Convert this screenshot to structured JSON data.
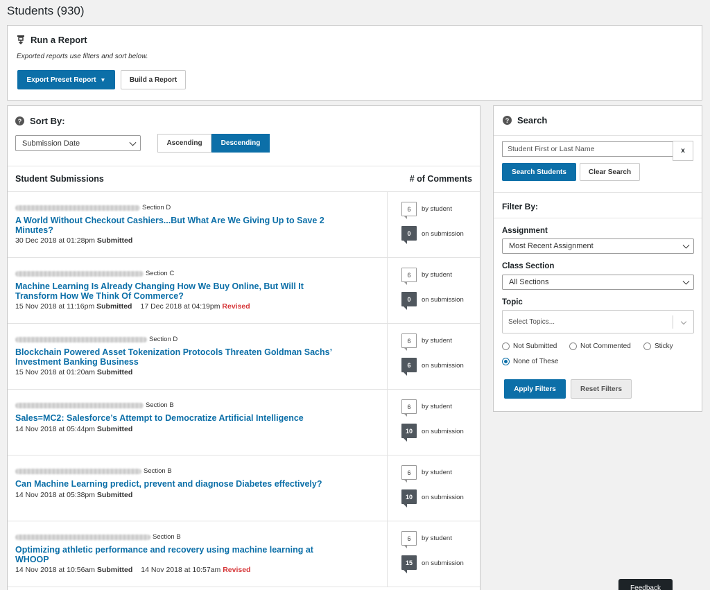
{
  "page": {
    "title": "Students (930)"
  },
  "report": {
    "heading": "Run a Report",
    "note": "Exported reports use filters and sort below.",
    "export_label": "Export Preset Report",
    "build_label": "Build a Report"
  },
  "sort": {
    "heading": "Sort By:",
    "selected": "Submission Date",
    "ascending": "Ascending",
    "descending": "Descending",
    "active": "Descending"
  },
  "list": {
    "header_left": "Student Submissions",
    "header_right": "# of Comments",
    "by_student_label": "by student",
    "on_submission_label": "on submission",
    "submitted_word": "Submitted",
    "revised_word": "Revised",
    "rows": [
      {
        "section": "Section D",
        "title": "A World Without Checkout Cashiers...But What Are We Giving Up to Save 2 Minutes?",
        "date": "30 Dec 2018 at 01:28pm",
        "revised_date": "",
        "by_student": "6",
        "on_submission": "0"
      },
      {
        "section": "Section C",
        "title": "Machine Learning Is Already Changing How We Buy Online, But Will It Transform How We Think Of Commerce?",
        "date": "15 Nov 2018 at 11:16pm",
        "revised_date": "17 Dec 2018 at 04:19pm",
        "by_student": "6",
        "on_submission": "0"
      },
      {
        "section": "Section D",
        "title": "Blockchain Powered Asset Tokenization Protocols Threaten Goldman Sachs’ Investment Banking Business",
        "date": "15 Nov 2018 at 01:20am",
        "revised_date": "",
        "by_student": "6",
        "on_submission": "6"
      },
      {
        "section": "Section B",
        "title": "Sales=MC2: Salesforce’s Attempt to Democratize Artificial Intelligence",
        "date": "14 Nov 2018 at 05:44pm",
        "revised_date": "",
        "by_student": "6",
        "on_submission": "10"
      },
      {
        "section": "Section B",
        "title": "Can Machine Learning predict, prevent and diagnose Diabetes effectively?",
        "date": "14 Nov 2018 at 05:38pm",
        "revised_date": "",
        "by_student": "6",
        "on_submission": "10"
      },
      {
        "section": "Section B",
        "title": "Optimizing athletic performance and recovery using machine learning at WHOOP",
        "date": "14 Nov 2018 at 10:56am",
        "revised_date": "14 Nov 2018 at 10:57am",
        "by_student": "6",
        "on_submission": "15"
      }
    ]
  },
  "search": {
    "heading": "Search",
    "placeholder": "Student First or Last Name",
    "clear_x": "x",
    "search_label": "Search Students",
    "clear_label": "Clear Search"
  },
  "filter": {
    "heading": "Filter By:",
    "assignment_label": "Assignment",
    "assignment_value": "Most Recent Assignment",
    "section_label": "Class Section",
    "section_value": "All Sections",
    "topic_label": "Topic",
    "topic_placeholder": "Select Topics...",
    "options": [
      "Not Submitted",
      "Not Commented",
      "Sticky",
      "None of These"
    ],
    "selected_option": "None of These",
    "apply_label": "Apply Filters",
    "reset_label": "Reset Filters"
  },
  "feedback": {
    "label": "Feedback"
  },
  "colors": {
    "primary": "#0c6fa8",
    "revised": "#d63638",
    "dark_bubble": "#50575e"
  }
}
